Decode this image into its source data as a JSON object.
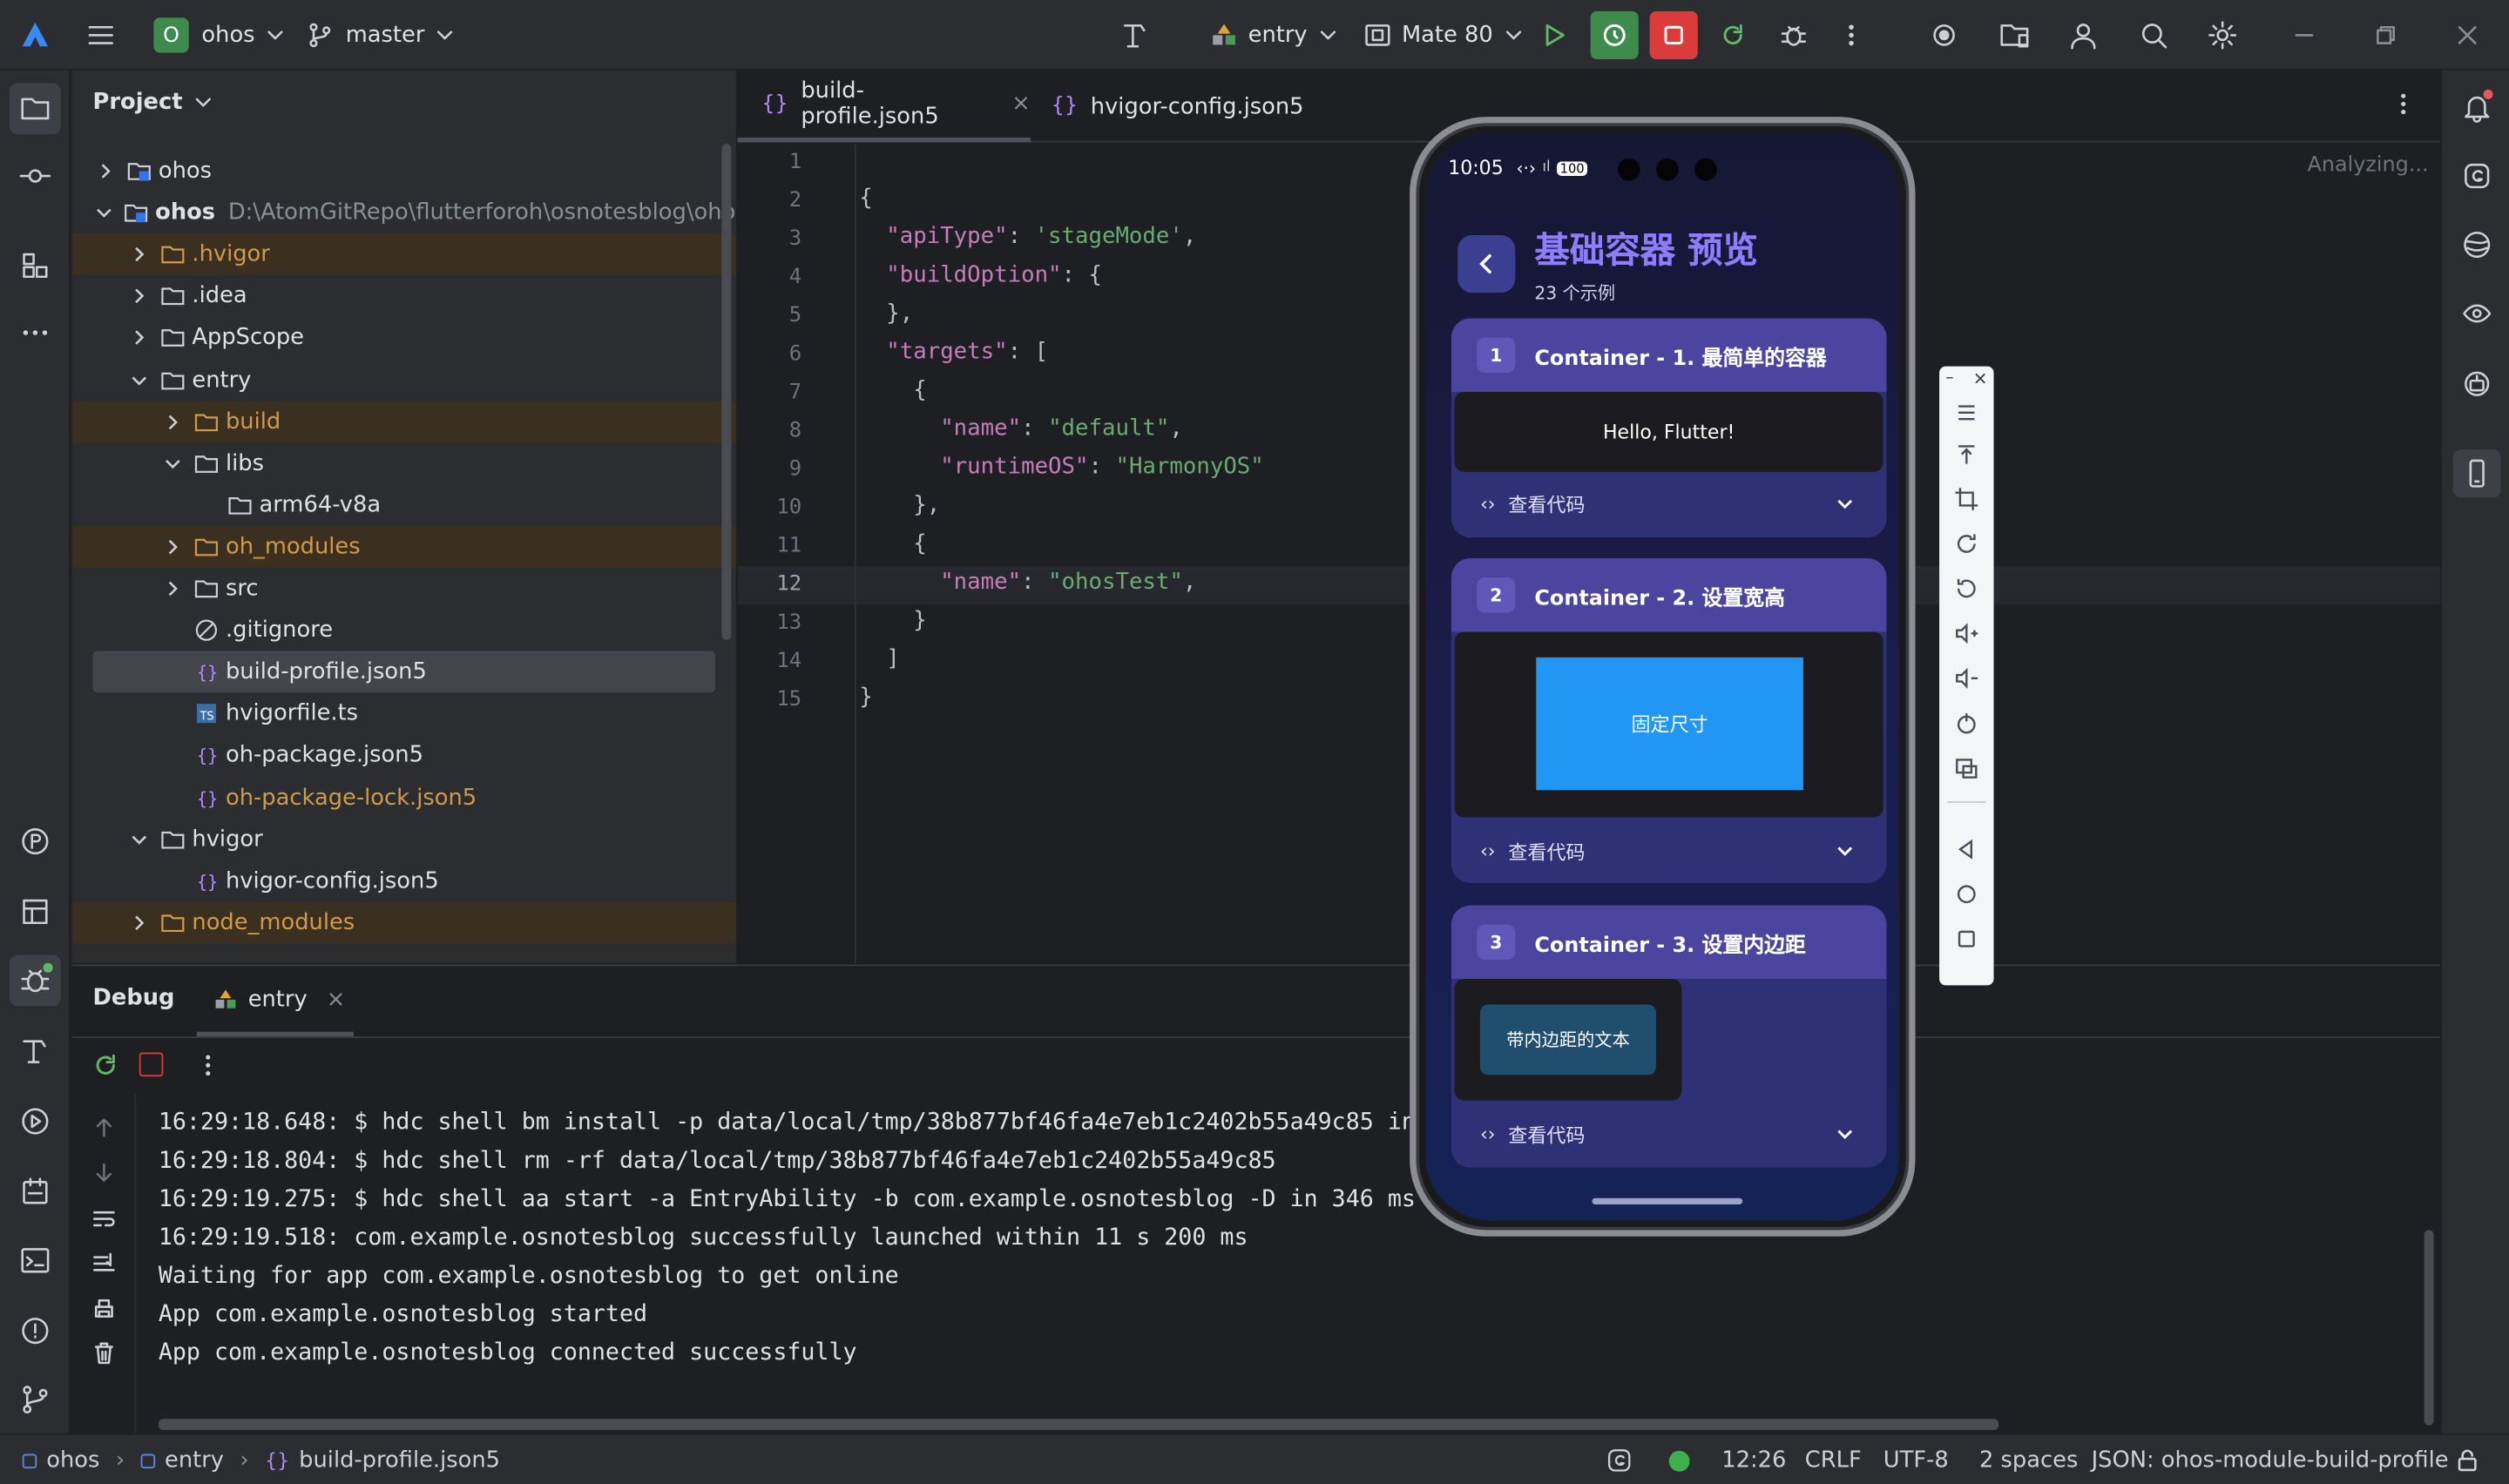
{
  "titlebar": {
    "project_badge": "O",
    "project_name": "ohos",
    "branch": "master",
    "run_config": "entry",
    "device": "Mate 80"
  },
  "project_panel": {
    "title": "Project",
    "tree": [
      {
        "label": "ohos",
        "path": "",
        "icon": "module",
        "expanded": false
      },
      {
        "label": "ohos",
        "path": "D:\\AtomGitRepo\\flutterforoh\\osnotesblog\\ohos",
        "icon": "module",
        "expanded": true
      },
      {
        "label": ".hvigor",
        "icon": "folder-orange",
        "expanded": false
      },
      {
        "label": ".idea",
        "icon": "folder",
        "expanded": false
      },
      {
        "label": "AppScope",
        "icon": "folder",
        "expanded": false
      },
      {
        "label": "entry",
        "icon": "folder",
        "expanded": true
      },
      {
        "label": "build",
        "icon": "folder-orange",
        "expanded": false
      },
      {
        "label": "libs",
        "icon": "folder",
        "expanded": true
      },
      {
        "label": "arm64-v8a",
        "icon": "folder"
      },
      {
        "label": "oh_modules",
        "icon": "folder-orange",
        "expanded": false
      },
      {
        "label": "src",
        "icon": "folder",
        "expanded": false
      },
      {
        "label": ".gitignore",
        "icon": "ignore"
      },
      {
        "label": "build-profile.json5",
        "icon": "json"
      },
      {
        "label": "hvigorfile.ts",
        "icon": "ts"
      },
      {
        "label": "oh-package.json5",
        "icon": "json"
      },
      {
        "label": "oh-package-lock.json5",
        "icon": "json"
      },
      {
        "label": "hvigor",
        "icon": "folder",
        "expanded": true
      },
      {
        "label": "hvigor-config.json5",
        "icon": "json"
      },
      {
        "label": "node_modules",
        "icon": "folder-orange",
        "expanded": false
      }
    ]
  },
  "editor": {
    "tabs": [
      {
        "label": "build-profile.json5",
        "active": true
      },
      {
        "label": "hvigor-config.json5",
        "active": false
      }
    ],
    "status": "Analyzing...",
    "line_numbers": [
      "1",
      "2",
      "3",
      "4",
      "5",
      "6",
      "7",
      "8",
      "9",
      "10",
      "11",
      "12",
      "13",
      "14",
      "15"
    ],
    "code": {
      "l2": "{",
      "l3k": "\"apiType\"",
      "l3v": "'stageMode'",
      "l4k": "\"buildOption\"",
      "l4v": "{",
      "l5": "},",
      "l6k": "\"targets\"",
      "l6v": "[",
      "l7": "{",
      "l8k": "\"name\"",
      "l8v": "\"default\"",
      "l9k": "\"runtimeOS\"",
      "l9v": "\"HarmonyOS\"",
      "l10": "},",
      "l11": "{",
      "l12k": "\"name\"",
      "l12v": "\"ohosTest\"",
      "l13": "}",
      "l14": "]",
      "l15": "}"
    }
  },
  "debug": {
    "title": "Debug",
    "tab": "entry",
    "console": [
      "16:29:18.648: $ hdc shell bm install -p data/local/tmp/38b877bf46fa4e7eb1c2402b55a49c85 in",
      "16:29:18.804: $ hdc shell rm -rf data/local/tmp/38b877bf46fa4e7eb1c2402b55a49c85",
      "16:29:19.275: $ hdc shell aa start -a EntryAbility -b com.example.osnotesblog -D in 346 ms",
      "16:29:19.518: com.example.osnotesblog successfully launched within 11 s 200 ms",
      "Waiting for app com.example.osnotesblog to get online",
      "App com.example.osnotesblog started",
      "App com.example.osnotesblog connected successfully"
    ]
  },
  "statusbar": {
    "crumbs": [
      "ohos",
      "entry",
      "build-profile.json5"
    ],
    "position": "12:26",
    "line_sep": "CRLF",
    "encoding": "UTF-8",
    "indent": "2 spaces",
    "schema": "JSON: ohos-module-build-profile"
  },
  "phone": {
    "time": "10:05",
    "battery": "100",
    "title": "基础容器 预览",
    "subtitle": "23 个示例",
    "cards": [
      {
        "num": "1",
        "title": "Container - 1. 最简单的容器",
        "content": "Hello, Flutter!",
        "code_label": "查看代码"
      },
      {
        "num": "2",
        "title": "Container - 2. 设置宽高",
        "content": "固定尺寸",
        "code_label": "查看代码"
      },
      {
        "num": "3",
        "title": "Container - 3. 设置内边距",
        "content": "带内边距的文本",
        "code_label": "查看代码"
      }
    ]
  },
  "colors": {
    "accent": "#3574f0",
    "run_green": "#4a9b56",
    "stop_red": "#db3b3b",
    "phone_title": "#8f7cff",
    "blue_box": "#2196f3"
  }
}
